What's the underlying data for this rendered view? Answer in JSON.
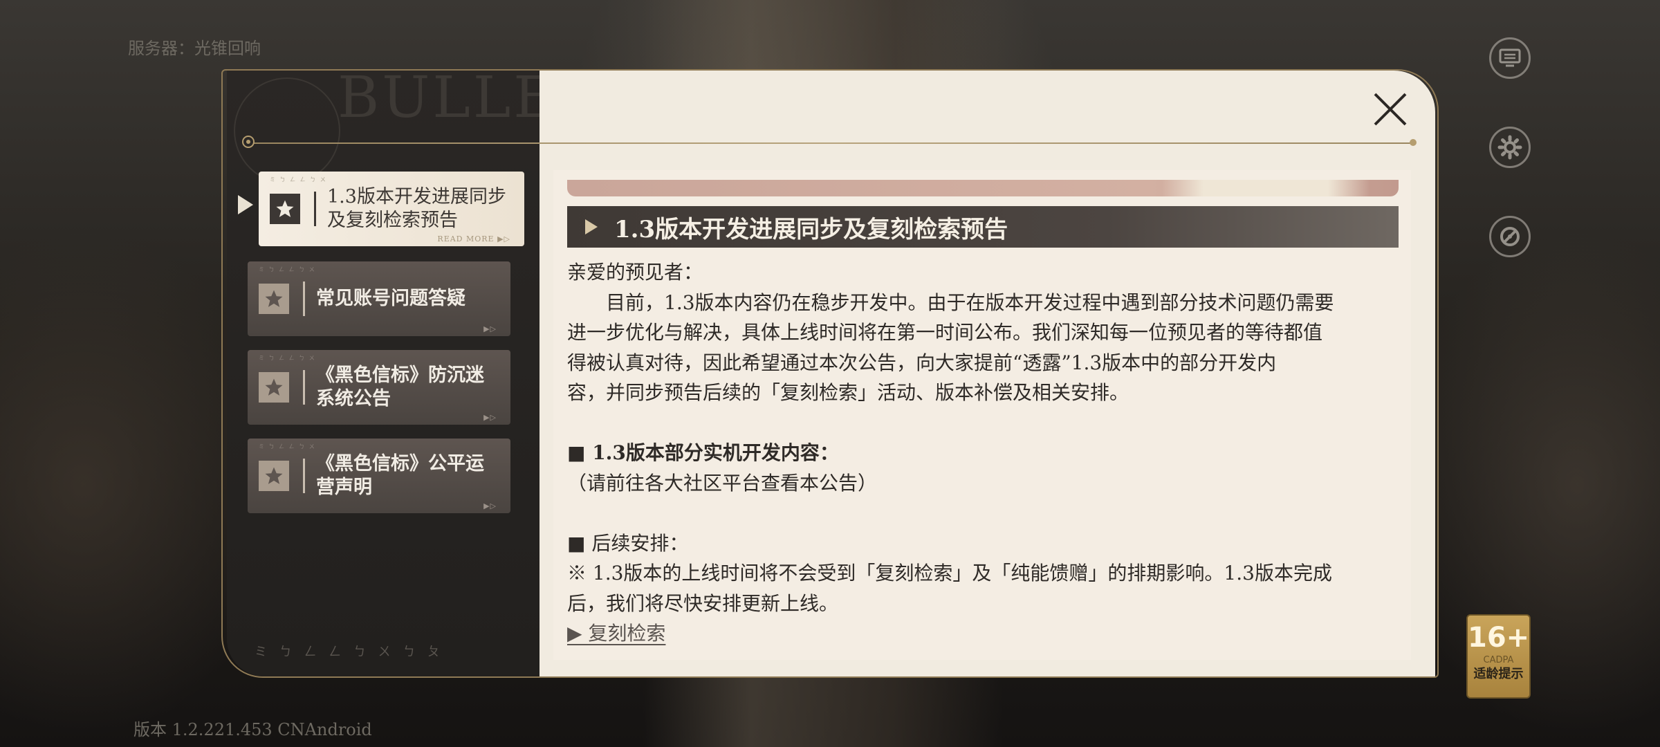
{
  "status": {
    "server": "服务器：光锥回响",
    "version": "版本 1.2.221.453 CNAndroid"
  },
  "side_buttons": [
    {
      "icon": "notice-board-icon"
    },
    {
      "icon": "gear-icon"
    },
    {
      "icon": "settings-wrench-icon"
    }
  ],
  "age_badge": {
    "age": "16+",
    "org": "CADPA",
    "tip": "适龄提示",
    "color": "#c9a45a"
  },
  "dialog": {
    "header_word": "BULLET",
    "close_icon": "close-icon",
    "footer_glyphs": "ミ ㄅ ㄥ ㄥ ㄅ ㄨ ㄅ ㄆ"
  },
  "notices": [
    {
      "label_line1": "1.3版本开发进展同步",
      "label_line2": "及复刻检索预告",
      "more": "READ MORE ▶▷",
      "active": true
    },
    {
      "label_line1": "常见账号问题答疑",
      "label_line2": "",
      "more": "▶▷",
      "active": false
    },
    {
      "label_line1": "《黑色信标》防沉迷",
      "label_line2": "系统公告",
      "more": "▶▷",
      "active": false
    },
    {
      "label_line1": "《黑色信标》公平运",
      "label_line2": "营声明",
      "more": "▶▷",
      "active": false
    }
  ],
  "article": {
    "title": "1.3版本开发进展同步及复刻检索预告",
    "greeting": "亲爱的预见者：",
    "para1_line1": "目前，1.3版本内容仍在稳步开发中。由于在版本开发过程中遇到部分技术问题仍需要",
    "para1_line2": "进一步优化与解决，具体上线时间将在第一时间公布。我们深知每一位预见者的等待都值",
    "para1_line3": "得被认真对待，因此希望通过本次公告，向大家提前“透露”1.3版本中的部分开发内",
    "para1_line4": "容，并同步预告后续的「复刻检索」活动、版本补偿及相关安排。",
    "section1_heading": "■ 1.3版本部分实机开发内容：",
    "section1_text": "（请前往各大社区平台查看本公告）",
    "section2_heading": "■ 后续安排：",
    "section2_line1": "※ 1.3版本的上线时间将不会受到「复刻检索」及「纯能馈赠」的排期影响。1.3版本完成",
    "section2_line2": "后，我们将尽快安排更新上线。",
    "link_text": "▶ 复刻检索"
  },
  "colors": {
    "accent_gold": "#b59d6f",
    "panel_dark": "#2a2725",
    "panel_light": "#f1ebe0",
    "title_bar": "#3f3935"
  }
}
